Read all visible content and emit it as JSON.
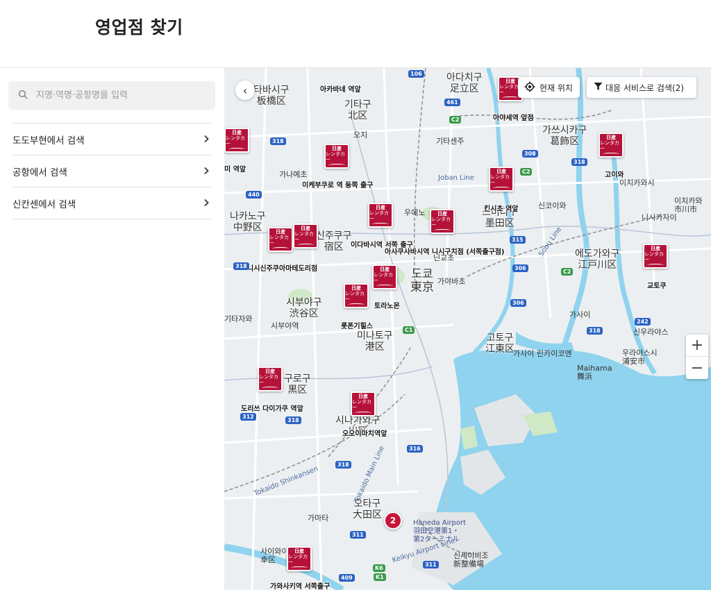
{
  "header": {
    "title": "영업점 찾기"
  },
  "search": {
    "placeholder": "지명·역명·공항명을 입력",
    "value": ""
  },
  "nav": {
    "items": [
      {
        "label": "도도부현에서 검색"
      },
      {
        "label": "공항에서 검색"
      },
      {
        "label": "신칸센에서 검색"
      }
    ]
  },
  "map_controls": {
    "back_label": "‹",
    "current_location_label": "현재 위치",
    "filter_label": "대응 서비스로 검색(2)",
    "zoom_in": "+",
    "zoom_out": "−"
  },
  "map": {
    "wards": [
      "타바시구\n板橋区",
      "기타구\n北区",
      "아다치구\n足立区",
      "가쓰시카구\n葛飾区",
      "나카노구\n中野区",
      "스미다구\n墨田区",
      "에도가와구\n江戸川区",
      "시부야구\n渋谷区",
      "미나토구\n港区",
      "고토구\n江東区",
      "구로구\n黒区",
      "시나가와구\n川区",
      "오타구\n大田区",
      "신주쿠구\n宿区"
    ],
    "city": "도쿄\n東京",
    "stations": [
      "아카바네 역앞",
      "아야세역 앞점",
      "고이와",
      "이케부쿠로 역 동쪽 출구",
      "킨시초 역앞",
      "이다바시역 서쪽 출구",
      "아사쿠사바시역 니시구치점 (서쪽출구점)",
      "니시신주쿠아마테도리점",
      "토라노몬",
      "롯폰기힐스",
      "교토쿠",
      "도리쓰 다이가쿠 역앞",
      "오오이마치역앞",
      "가와사키역 서쪽출구",
      "미 역앞"
    ],
    "places": [
      "오지",
      "기타센주",
      "가나메초",
      "신코이와",
      "이치카와시",
      "이치카와\n市川市",
      "니시카사이",
      "가사이",
      "신우라야스",
      "우라야스시\n浦安市",
      "가사이 린카이코엔",
      "우에노",
      "닌교초",
      "가야바초",
      "기타자와",
      "시부야역",
      "사이와이구\n幸区",
      "가마타",
      "Maihama\n舞浜",
      "신세이비조\n新整備場",
      "Haneda Airport\n羽田空港第1・\n第2ターミナル"
    ],
    "lines": [
      "Joban Line",
      "Sobu Line",
      "Tokaido Shinkansen",
      "Tokaido Main Line",
      "Keikyu Airport Line",
      "Kyoto Line"
    ],
    "cluster_count": "2",
    "marker_brand": {
      "top": "日産",
      "bottom": "レンタカー"
    }
  },
  "colors": {
    "brand_red": "#b5123a",
    "water": "#8fd3ee",
    "land": "#eceff1",
    "park": "#cfe9c6"
  }
}
